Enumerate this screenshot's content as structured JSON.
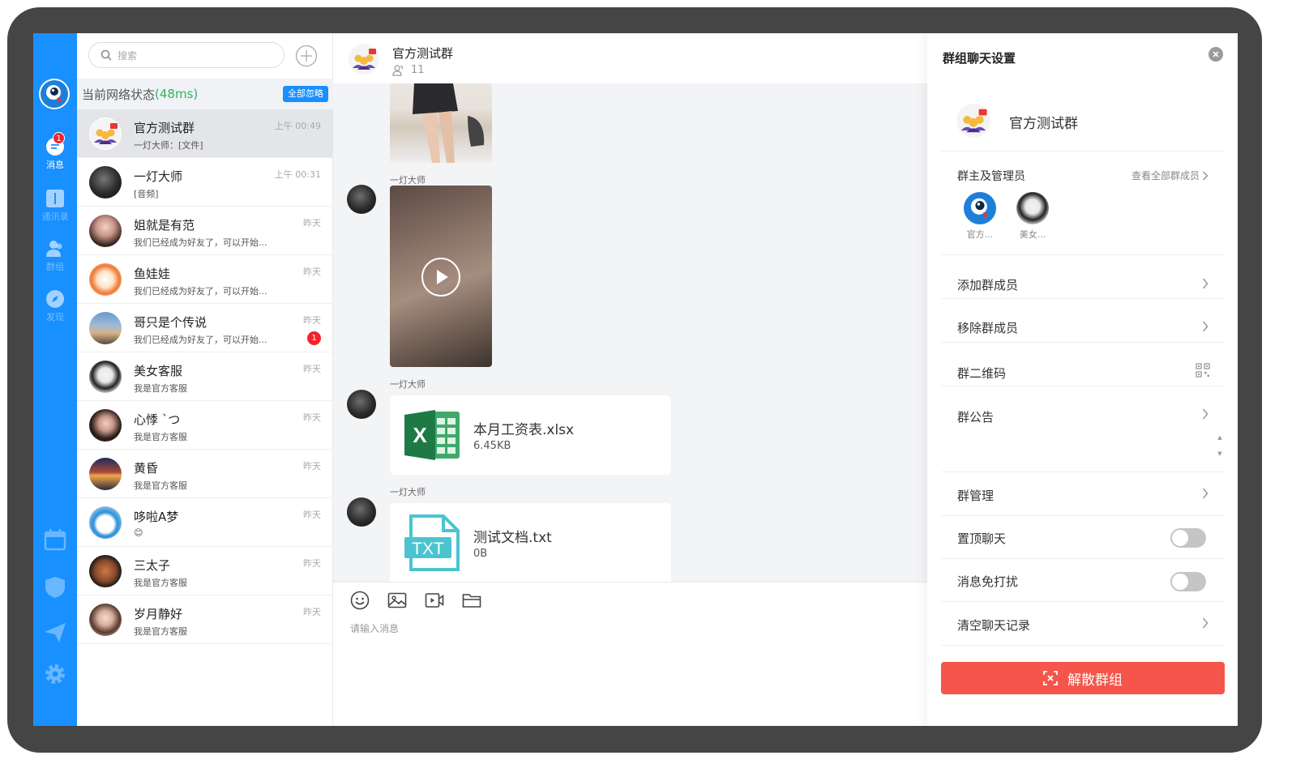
{
  "nav": {
    "items": [
      {
        "label": "消息",
        "icon": "message-icon",
        "badge": "1"
      },
      {
        "label": "通讯录",
        "icon": "contacts-icon"
      },
      {
        "label": "群组",
        "icon": "group-icon"
      },
      {
        "label": "发现",
        "icon": "compass-icon"
      }
    ],
    "bottom_icons": [
      "calendar-icon",
      "shield-icon",
      "send-icon",
      "settings-icon"
    ],
    "accent": "#1890ff"
  },
  "conversations": {
    "search_placeholder": "搜索",
    "network_label": "当前网络状态",
    "network_latency": "(48ms)",
    "ignore_all_label": "全部忽略",
    "items": [
      {
        "name": "官方测试群",
        "preview": "一灯大师：[文件]",
        "time": "上午 00:49",
        "avatar": "group-avatar-icon"
      },
      {
        "name": "一灯大师",
        "preview": "[音频]",
        "time": "上午 00:31",
        "avatar": "user-avatar"
      },
      {
        "name": "姐就是有范",
        "preview": "我们已经成为好友了，可以开始...",
        "time": "昨天",
        "avatar": "user-avatar"
      },
      {
        "name": "鱼娃娃",
        "preview": "我们已经成为好友了，可以开始...",
        "time": "昨天",
        "avatar": "user-avatar"
      },
      {
        "name": "哥只是个传说",
        "preview": "我们已经成为好友了，可以开始...",
        "time": "昨天",
        "badge": "1",
        "avatar": "user-avatar"
      },
      {
        "name": "美女客服",
        "preview": "我是官方客服",
        "time": "昨天",
        "avatar": "user-avatar"
      },
      {
        "name": "心悸 ˋつ",
        "preview": "我是官方客服",
        "time": "昨天",
        "avatar": "user-avatar"
      },
      {
        "name": "黄昏",
        "preview": "我是官方客服",
        "time": "昨天",
        "avatar": "user-avatar"
      },
      {
        "name": "哆啦A梦",
        "preview": "😊",
        "time": "昨天",
        "avatar": "user-avatar"
      },
      {
        "name": "三太子",
        "preview": "我是官方客服",
        "time": "昨天",
        "avatar": "user-avatar"
      },
      {
        "name": "岁月静好",
        "preview": "我是官方客服",
        "time": "昨天",
        "avatar": "user-avatar"
      }
    ]
  },
  "chat": {
    "title": "官方测试群",
    "member_count": "11",
    "messages": [
      {
        "type": "image",
        "sender": ""
      },
      {
        "type": "video",
        "sender": "一灯大师"
      },
      {
        "type": "file",
        "sender": "一灯大师",
        "file_name": "本月工资表.xlsx",
        "file_size": "6.45KB",
        "file_icon": "excel-icon"
      },
      {
        "type": "file",
        "sender": "一灯大师",
        "file_name": "测试文档.txt",
        "file_size": "0B",
        "file_icon": "txt-icon"
      }
    ],
    "composer_placeholder": "请输入消息",
    "tools": [
      "emoji-icon",
      "image-icon",
      "video-icon",
      "folder-icon"
    ]
  },
  "settings": {
    "title": "群组聊天设置",
    "group_name": "官方测试群",
    "admins_title": "群主及管理员",
    "view_all_label": "查看全部群成员",
    "admins": [
      {
        "name": "官方..."
      },
      {
        "name": "美女..."
      }
    ],
    "rows": [
      {
        "label": "添加群成员",
        "control": "chevron"
      },
      {
        "label": "移除群成员",
        "control": "chevron"
      },
      {
        "label": "群二维码",
        "control": "qrcode"
      },
      {
        "label": "群公告",
        "control": "chevron"
      },
      {
        "label": "群管理",
        "control": "chevron"
      },
      {
        "label": "置顶聊天",
        "control": "toggle",
        "on": false
      },
      {
        "label": "消息免打扰",
        "control": "toggle",
        "on": false
      },
      {
        "label": "清空聊天记录",
        "control": "chevron"
      }
    ],
    "disband_label": "解散群组",
    "danger_color": "#f5554a"
  }
}
